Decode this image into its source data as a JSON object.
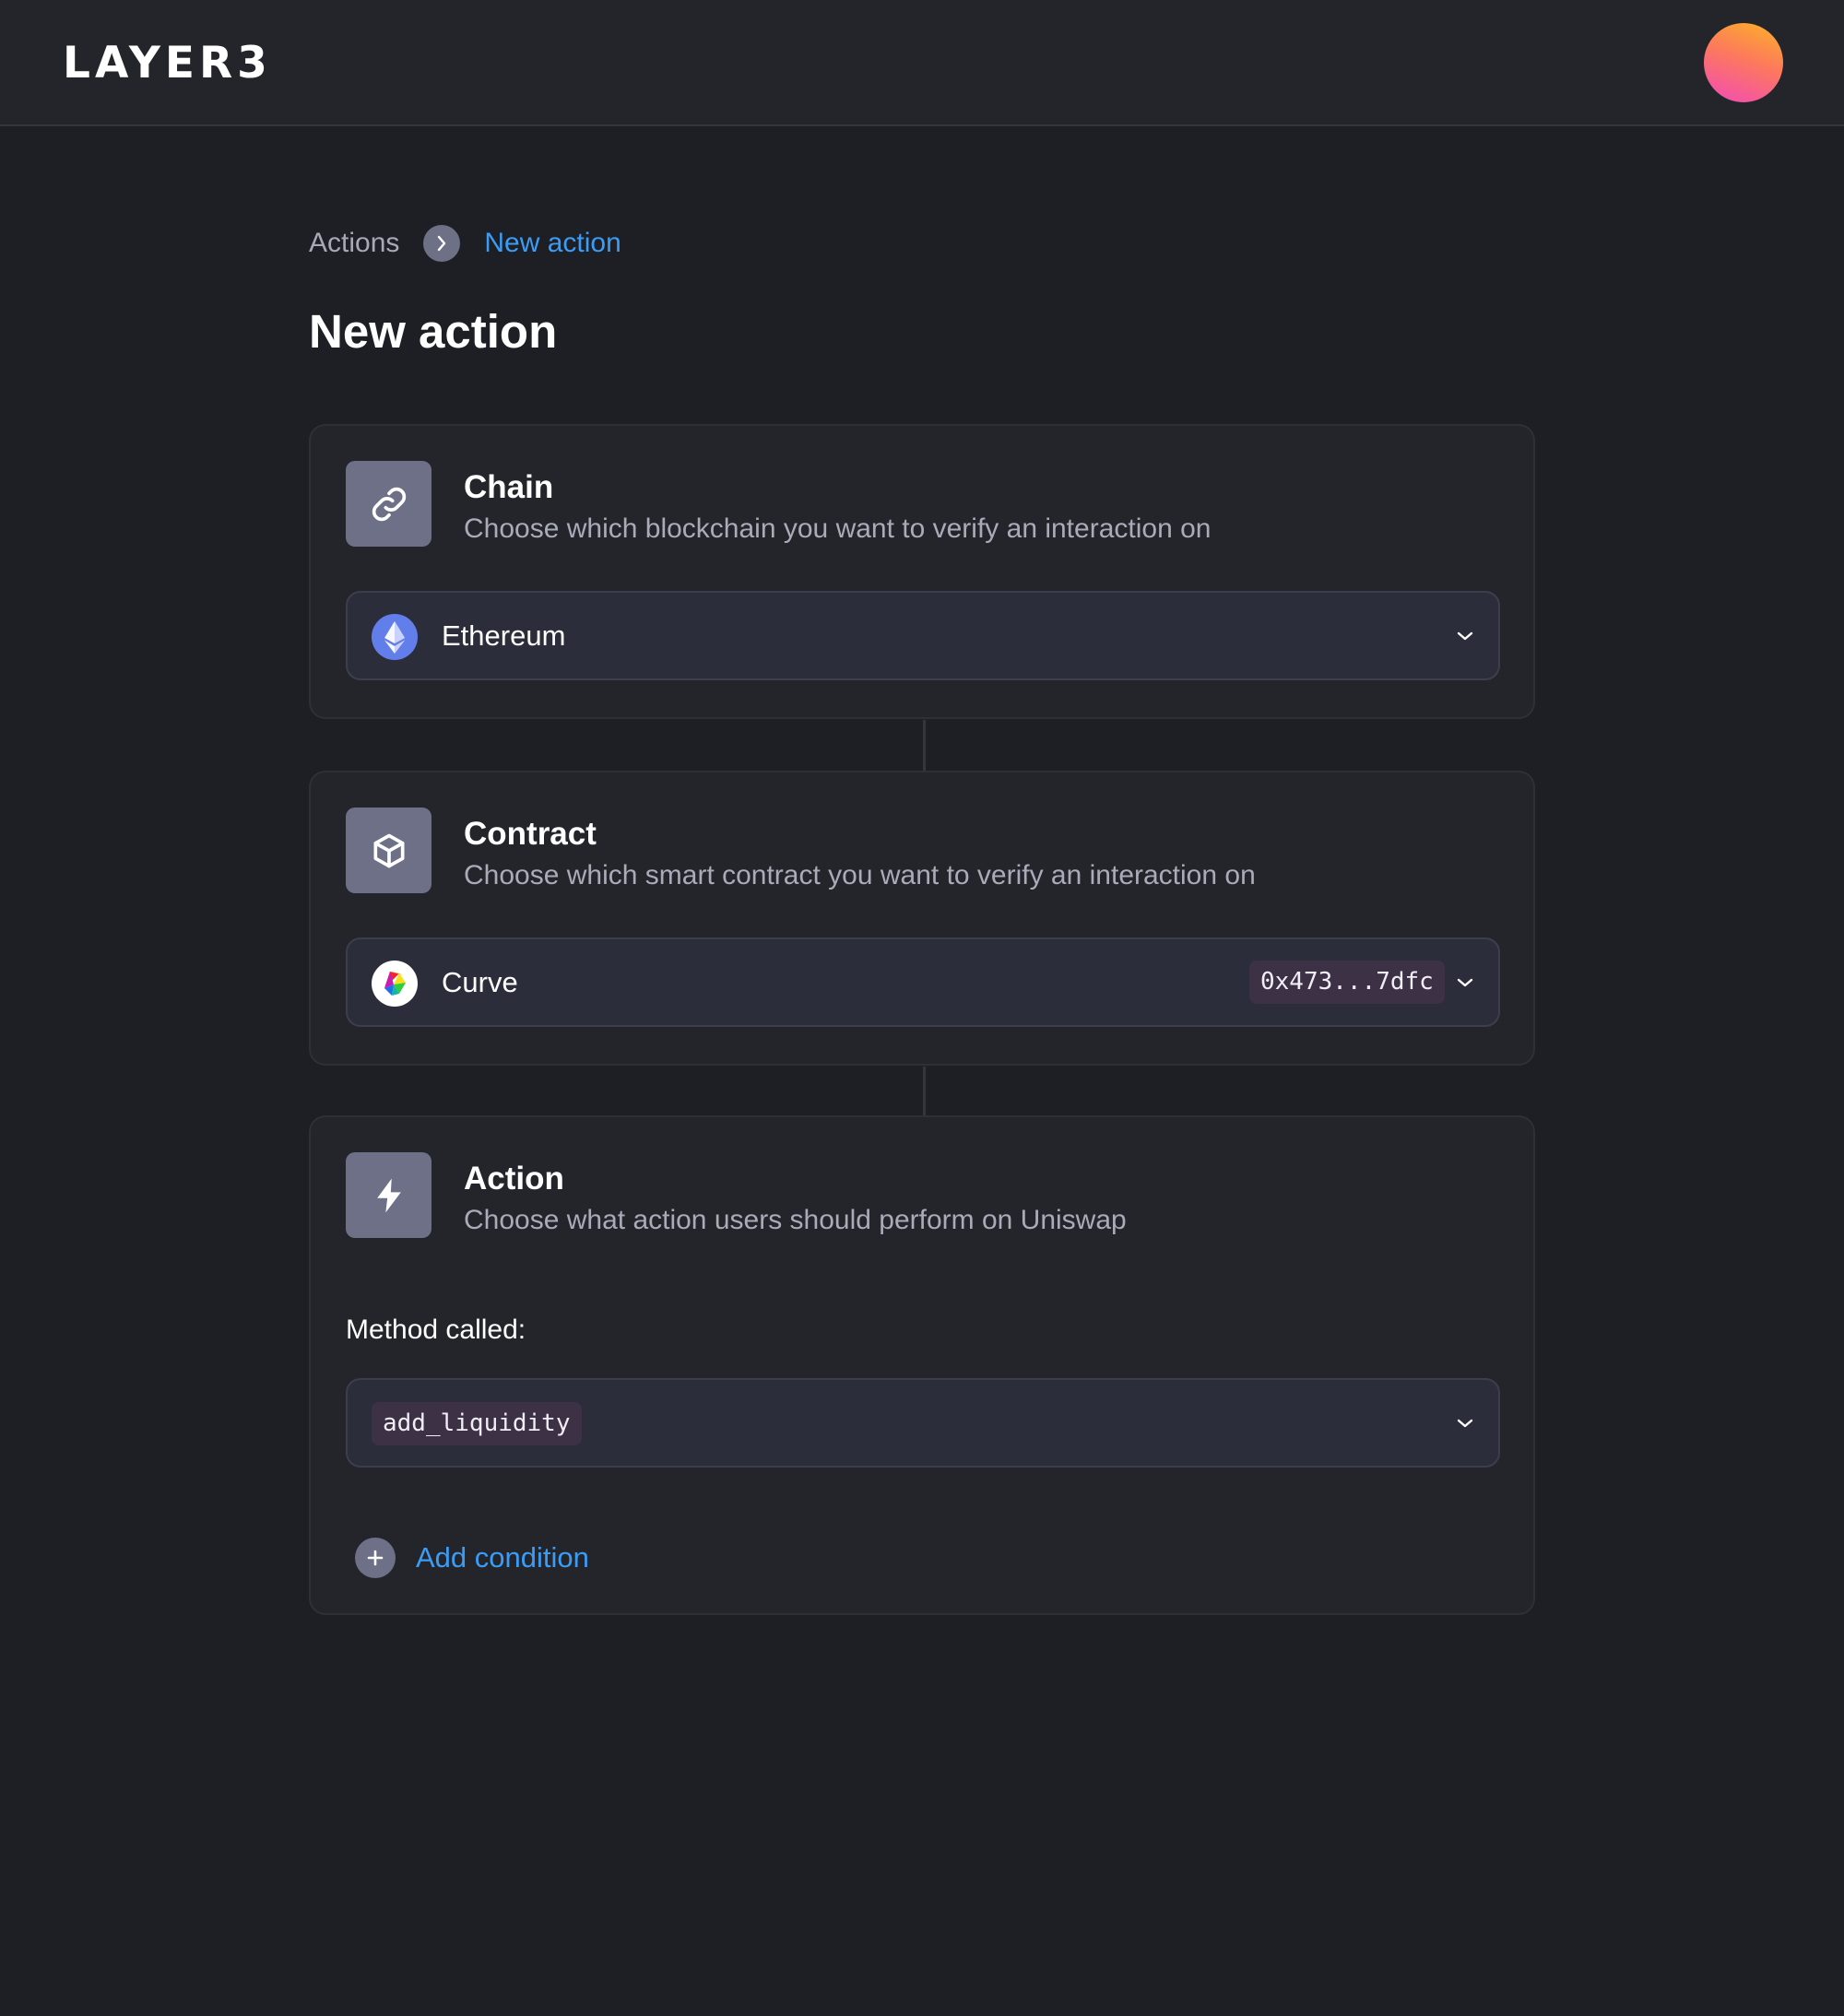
{
  "header": {
    "logo": "LAYER3",
    "avatar_gradient": [
      "#fbb326",
      "#f24ab8"
    ]
  },
  "breadcrumb": {
    "root": "Actions",
    "separator_icon": "chevron-right-icon",
    "current": "New action"
  },
  "page": {
    "title": "New action"
  },
  "steps": {
    "chain": {
      "icon": "link-icon",
      "title": "Chain",
      "description": "Choose which blockchain you want to verify an interaction on",
      "select": {
        "icon": "ethereum-icon",
        "value": "Ethereum"
      }
    },
    "contract": {
      "icon": "cube-icon",
      "title": "Contract",
      "description": "Choose which smart contract you want to verify an interaction on",
      "select": {
        "icon": "curve-logo-icon",
        "value": "Curve",
        "address": "0x473...7dfc"
      }
    },
    "action": {
      "icon": "lightning-icon",
      "title": "Action",
      "description": "Choose what action users should perform on Uniswap",
      "method_label": "Method called:",
      "method_value": "add_liquidity",
      "add_condition_label": "Add condition"
    }
  },
  "colors": {
    "background": "#1e1f25",
    "card": "#23252b",
    "accent_link": "#3b9cf5",
    "icon_tile": "#6d7087",
    "code_pill": "#3d3146"
  }
}
